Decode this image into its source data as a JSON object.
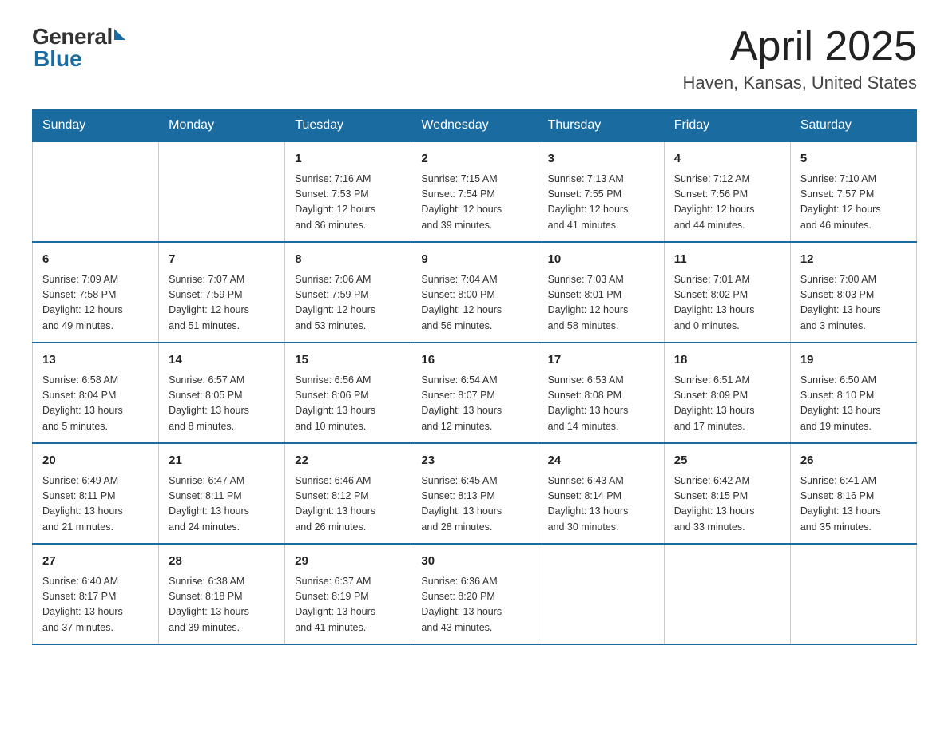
{
  "header": {
    "logo_general": "General",
    "logo_blue": "Blue",
    "title": "April 2025",
    "location": "Haven, Kansas, United States"
  },
  "days_of_week": [
    "Sunday",
    "Monday",
    "Tuesday",
    "Wednesday",
    "Thursday",
    "Friday",
    "Saturday"
  ],
  "weeks": [
    [
      {
        "day": "",
        "info": ""
      },
      {
        "day": "",
        "info": ""
      },
      {
        "day": "1",
        "info": "Sunrise: 7:16 AM\nSunset: 7:53 PM\nDaylight: 12 hours\nand 36 minutes."
      },
      {
        "day": "2",
        "info": "Sunrise: 7:15 AM\nSunset: 7:54 PM\nDaylight: 12 hours\nand 39 minutes."
      },
      {
        "day": "3",
        "info": "Sunrise: 7:13 AM\nSunset: 7:55 PM\nDaylight: 12 hours\nand 41 minutes."
      },
      {
        "day": "4",
        "info": "Sunrise: 7:12 AM\nSunset: 7:56 PM\nDaylight: 12 hours\nand 44 minutes."
      },
      {
        "day": "5",
        "info": "Sunrise: 7:10 AM\nSunset: 7:57 PM\nDaylight: 12 hours\nand 46 minutes."
      }
    ],
    [
      {
        "day": "6",
        "info": "Sunrise: 7:09 AM\nSunset: 7:58 PM\nDaylight: 12 hours\nand 49 minutes."
      },
      {
        "day": "7",
        "info": "Sunrise: 7:07 AM\nSunset: 7:59 PM\nDaylight: 12 hours\nand 51 minutes."
      },
      {
        "day": "8",
        "info": "Sunrise: 7:06 AM\nSunset: 7:59 PM\nDaylight: 12 hours\nand 53 minutes."
      },
      {
        "day": "9",
        "info": "Sunrise: 7:04 AM\nSunset: 8:00 PM\nDaylight: 12 hours\nand 56 minutes."
      },
      {
        "day": "10",
        "info": "Sunrise: 7:03 AM\nSunset: 8:01 PM\nDaylight: 12 hours\nand 58 minutes."
      },
      {
        "day": "11",
        "info": "Sunrise: 7:01 AM\nSunset: 8:02 PM\nDaylight: 13 hours\nand 0 minutes."
      },
      {
        "day": "12",
        "info": "Sunrise: 7:00 AM\nSunset: 8:03 PM\nDaylight: 13 hours\nand 3 minutes."
      }
    ],
    [
      {
        "day": "13",
        "info": "Sunrise: 6:58 AM\nSunset: 8:04 PM\nDaylight: 13 hours\nand 5 minutes."
      },
      {
        "day": "14",
        "info": "Sunrise: 6:57 AM\nSunset: 8:05 PM\nDaylight: 13 hours\nand 8 minutes."
      },
      {
        "day": "15",
        "info": "Sunrise: 6:56 AM\nSunset: 8:06 PM\nDaylight: 13 hours\nand 10 minutes."
      },
      {
        "day": "16",
        "info": "Sunrise: 6:54 AM\nSunset: 8:07 PM\nDaylight: 13 hours\nand 12 minutes."
      },
      {
        "day": "17",
        "info": "Sunrise: 6:53 AM\nSunset: 8:08 PM\nDaylight: 13 hours\nand 14 minutes."
      },
      {
        "day": "18",
        "info": "Sunrise: 6:51 AM\nSunset: 8:09 PM\nDaylight: 13 hours\nand 17 minutes."
      },
      {
        "day": "19",
        "info": "Sunrise: 6:50 AM\nSunset: 8:10 PM\nDaylight: 13 hours\nand 19 minutes."
      }
    ],
    [
      {
        "day": "20",
        "info": "Sunrise: 6:49 AM\nSunset: 8:11 PM\nDaylight: 13 hours\nand 21 minutes."
      },
      {
        "day": "21",
        "info": "Sunrise: 6:47 AM\nSunset: 8:11 PM\nDaylight: 13 hours\nand 24 minutes."
      },
      {
        "day": "22",
        "info": "Sunrise: 6:46 AM\nSunset: 8:12 PM\nDaylight: 13 hours\nand 26 minutes."
      },
      {
        "day": "23",
        "info": "Sunrise: 6:45 AM\nSunset: 8:13 PM\nDaylight: 13 hours\nand 28 minutes."
      },
      {
        "day": "24",
        "info": "Sunrise: 6:43 AM\nSunset: 8:14 PM\nDaylight: 13 hours\nand 30 minutes."
      },
      {
        "day": "25",
        "info": "Sunrise: 6:42 AM\nSunset: 8:15 PM\nDaylight: 13 hours\nand 33 minutes."
      },
      {
        "day": "26",
        "info": "Sunrise: 6:41 AM\nSunset: 8:16 PM\nDaylight: 13 hours\nand 35 minutes."
      }
    ],
    [
      {
        "day": "27",
        "info": "Sunrise: 6:40 AM\nSunset: 8:17 PM\nDaylight: 13 hours\nand 37 minutes."
      },
      {
        "day": "28",
        "info": "Sunrise: 6:38 AM\nSunset: 8:18 PM\nDaylight: 13 hours\nand 39 minutes."
      },
      {
        "day": "29",
        "info": "Sunrise: 6:37 AM\nSunset: 8:19 PM\nDaylight: 13 hours\nand 41 minutes."
      },
      {
        "day": "30",
        "info": "Sunrise: 6:36 AM\nSunset: 8:20 PM\nDaylight: 13 hours\nand 43 minutes."
      },
      {
        "day": "",
        "info": ""
      },
      {
        "day": "",
        "info": ""
      },
      {
        "day": "",
        "info": ""
      }
    ]
  ]
}
